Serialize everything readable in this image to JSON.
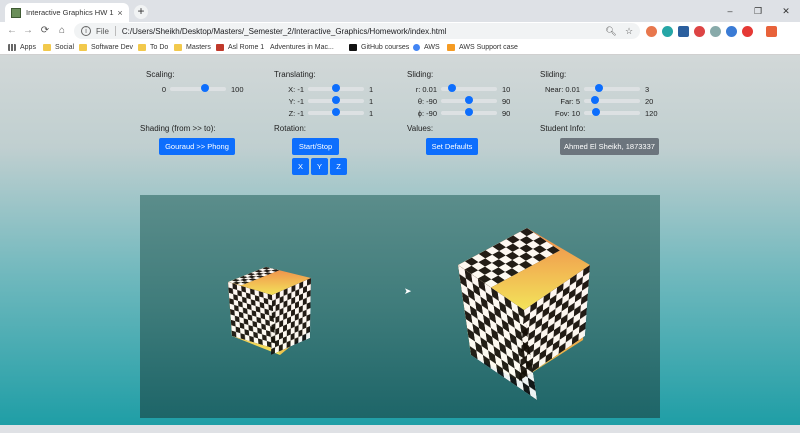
{
  "browser": {
    "tab_title": "Interactive Graphics HW 1",
    "tab_close": "×",
    "new_tab": "+",
    "window_controls": [
      "–",
      "❐",
      "✕"
    ],
    "nav": {
      "back": "←",
      "forward": "→",
      "reload": "⟳",
      "home": "⌂"
    },
    "address": {
      "scheme": "File",
      "url": "C:/Users/Sheikh/Desktop/Masters/_Semester_2/Interactive_Graphics/Homework/index.html"
    },
    "bookmarks": [
      {
        "label": "Apps",
        "icon": "apps-grid-icon"
      },
      {
        "label": "Social",
        "icon": "folder-icon"
      },
      {
        "label": "Software Dev",
        "icon": "folder-icon"
      },
      {
        "label": "To Do",
        "icon": "folder-icon"
      },
      {
        "label": "Masters",
        "icon": "folder-icon"
      },
      {
        "label": "Asl Rome 1",
        "icon": "rome-icon"
      },
      {
        "label": "Adventures in Mac...",
        "icon": "page-icon"
      },
      {
        "label": "GitHub courses",
        "icon": "dev-icon"
      },
      {
        "label": "AWS",
        "icon": "google-icon"
      },
      {
        "label": "AWS Support case",
        "icon": "aws-icon"
      }
    ]
  },
  "controls": {
    "scaling": {
      "heading": "Scaling:",
      "rows": [
        {
          "label": "",
          "min": "0",
          "max": "100",
          "fraction": 0.62
        }
      ]
    },
    "translating": {
      "heading": "Translating:",
      "rows": [
        {
          "label": "X: -1",
          "max": "1",
          "fraction": 0.5
        },
        {
          "label": "Y: -1",
          "max": "1",
          "fraction": 0.5
        },
        {
          "label": "Z: -1",
          "max": "1",
          "fraction": 0.5
        }
      ]
    },
    "sliding_camera": {
      "heading": "Sliding:",
      "rows": [
        {
          "label": "r: 0.01",
          "max": "10",
          "fraction": 0.2
        },
        {
          "label": "θ: -90",
          "max": "90",
          "fraction": 0.5
        },
        {
          "label": "ϕ: -90",
          "max": "90",
          "fraction": 0.5
        }
      ]
    },
    "sliding_projection": {
      "heading": "Sliding:",
      "rows": [
        {
          "label": "Near: 0.01",
          "max": "3",
          "fraction": 0.27
        },
        {
          "label": "Far: 5",
          "max": "20",
          "fraction": 0.2
        },
        {
          "label": "Fov: 10",
          "max": "120",
          "fraction": 0.22
        }
      ]
    },
    "shading": {
      "heading": "Shading (from >> to):",
      "button": "Gouraud >> Phong"
    },
    "rotation": {
      "heading": "Rotation:",
      "start_stop": "Start/Stop",
      "axes": [
        "X",
        "Y",
        "Z"
      ]
    },
    "values": {
      "heading": "Values:",
      "button": "Set Defaults"
    },
    "student": {
      "heading": "Student Info:",
      "button": "Ahmed El Sheikh, 1873337"
    }
  },
  "colors": {
    "accent": "#0d6efd",
    "student_button": "#6c757d",
    "checker_dark": "#111111",
    "checker_light_top": "#f08a4b",
    "checker_light_bottom": "#f3e35a"
  }
}
